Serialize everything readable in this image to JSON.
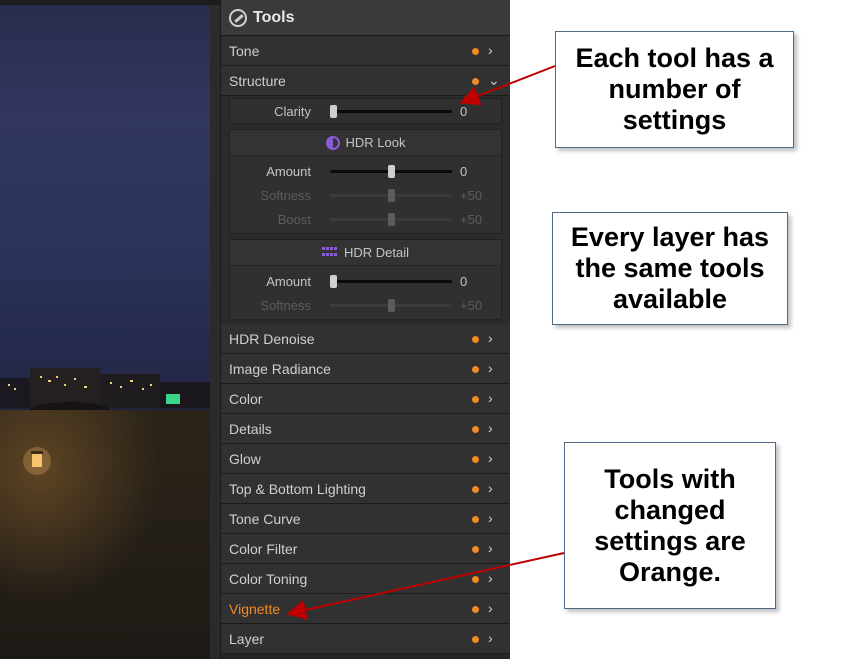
{
  "panel": {
    "title": "Tools",
    "tone_label": "Tone",
    "structure_label": "Structure",
    "clarity": {
      "label": "Clarity",
      "value": "0",
      "level": 0.0
    },
    "hdr_look": {
      "title": "HDR Look",
      "rows": [
        {
          "label": "Amount",
          "value": "0",
          "level": 0.5,
          "enabled": true
        },
        {
          "label": "Softness",
          "value": "+50",
          "level": 0.5,
          "enabled": false
        },
        {
          "label": "Boost",
          "value": "+50",
          "level": 0.5,
          "enabled": false
        }
      ]
    },
    "hdr_detail": {
      "title": "HDR Detail",
      "rows": [
        {
          "label": "Amount",
          "value": "0",
          "level": 0.0,
          "enabled": true
        },
        {
          "label": "Softness",
          "value": "+50",
          "level": 0.5,
          "enabled": false
        }
      ]
    },
    "tools": [
      {
        "label": "HDR Denoise",
        "orange": false
      },
      {
        "label": "Image Radiance",
        "orange": false
      },
      {
        "label": "Color",
        "orange": false
      },
      {
        "label": "Details",
        "orange": false
      },
      {
        "label": "Glow",
        "orange": false
      },
      {
        "label": "Top & Bottom Lighting",
        "orange": false
      },
      {
        "label": "Tone Curve",
        "orange": false
      },
      {
        "label": "Color Filter",
        "orange": false
      },
      {
        "label": "Color Toning",
        "orange": false
      },
      {
        "label": "Vignette",
        "orange": true
      },
      {
        "label": "Layer",
        "orange": false
      }
    ]
  },
  "callouts": {
    "c1": "Each tool has a number of settings",
    "c2": "Every layer has the same tools available",
    "c3": "Tools with changed settings are Orange."
  },
  "colors": {
    "accent": "#f08a24",
    "panel": "#262626",
    "arrow": "#c00000"
  }
}
